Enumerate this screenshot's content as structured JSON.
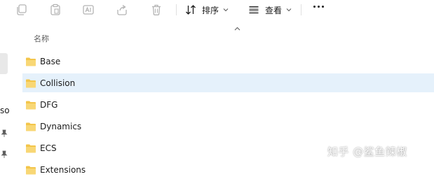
{
  "toolbar": {
    "sort_label": "排序",
    "view_label": "查看",
    "icons": [
      "copy-icon",
      "paste-icon",
      "rename-icon",
      "share-icon",
      "delete-icon",
      "sort-icon",
      "view-icon",
      "more-icon"
    ]
  },
  "sidebar": {
    "partial_label": "so"
  },
  "file_list": {
    "column_header": "名称",
    "items": [
      {
        "label": "Base",
        "selected": false
      },
      {
        "label": "Collision",
        "selected": true
      },
      {
        "label": "DFG",
        "selected": false
      },
      {
        "label": "Dynamics",
        "selected": false
      },
      {
        "label": "ECS",
        "selected": false
      },
      {
        "label": "Extensions",
        "selected": false
      }
    ]
  },
  "watermark": {
    "text": "知乎 @鲨鱼辣椒"
  },
  "colors": {
    "selection": "#e5f1fb",
    "folder": "#f3c54a",
    "icon_disabled": "#b4b4b4"
  }
}
